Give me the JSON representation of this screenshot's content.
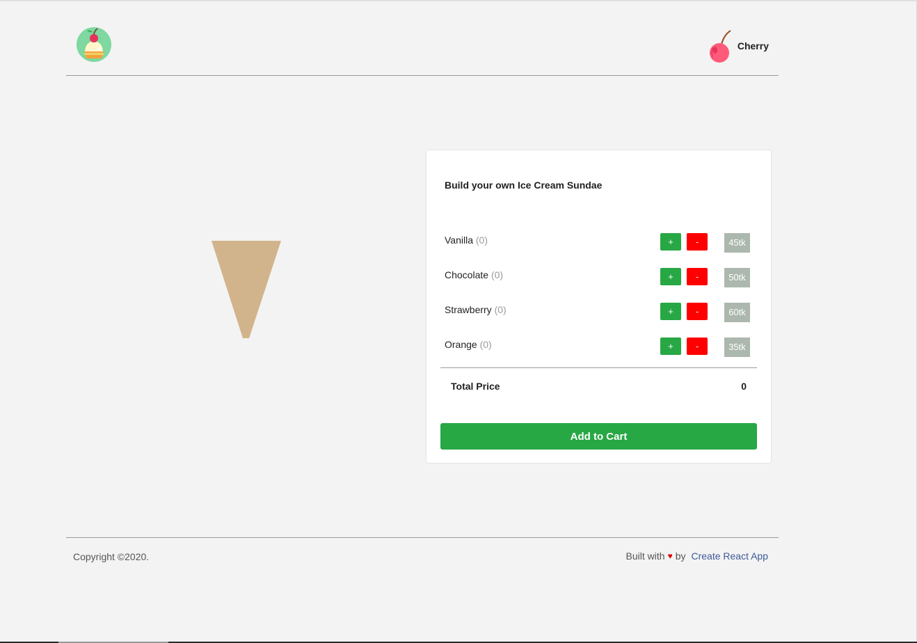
{
  "header": {
    "logo_icon": "sundae-logo-icon",
    "brand_icon": "cherry-icon",
    "brand_name": "Cherry"
  },
  "preview": {
    "cone_color": "#d2b48c"
  },
  "builder": {
    "title": "Build your own Ice Cream Sundae",
    "flavors": [
      {
        "name": "Vanilla",
        "count": "(0)",
        "plus": "+",
        "minus": "-",
        "price": "45tk"
      },
      {
        "name": "Chocolate",
        "count": "(0)",
        "plus": "+",
        "minus": "-",
        "price": "50tk"
      },
      {
        "name": "Strawberry",
        "count": "(0)",
        "plus": "+",
        "minus": "-",
        "price": "60tk"
      },
      {
        "name": "Orange",
        "count": "(0)",
        "plus": "+",
        "minus": "-",
        "price": "35tk"
      }
    ],
    "total_label": "Total Price",
    "total_value": "0",
    "cart_button": "Add to Cart"
  },
  "footer": {
    "copyright": "Copyright ©2020.",
    "built_with": "Built with",
    "heart_icon": "heart-icon",
    "by": "by",
    "link_text": "Create React App"
  },
  "colors": {
    "background": "#f3f3f3",
    "add_button": "#28a745",
    "remove_button": "#ff0000",
    "price_tag": "#acb7ad",
    "link": "#3d5a99"
  }
}
